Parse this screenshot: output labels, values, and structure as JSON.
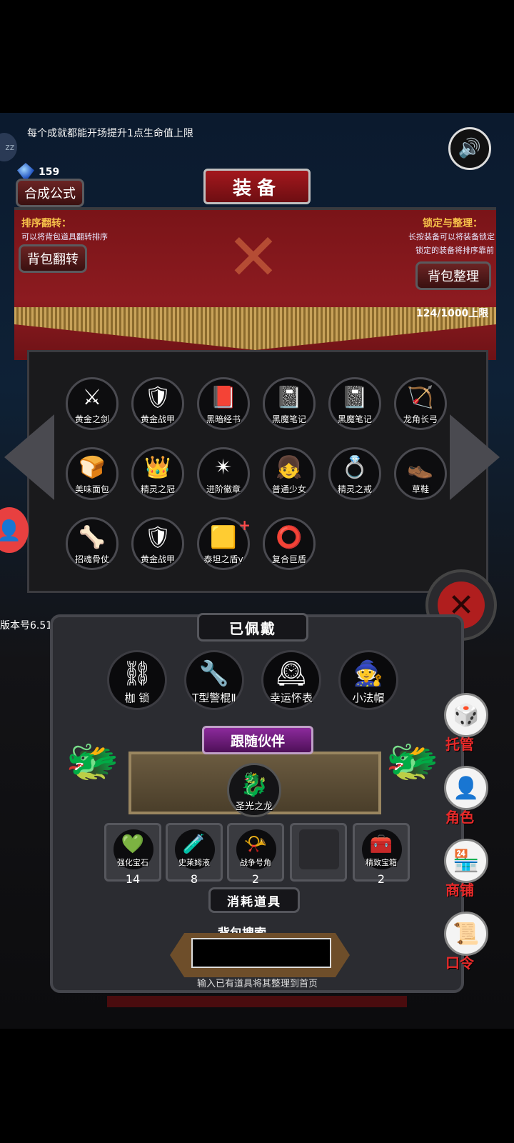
{
  "top_tip": "每个成就都能开场提升1点生命值上限",
  "gems": {
    "count": "159"
  },
  "sleep_label": "zz",
  "icons": {
    "sound": "speaker-icon",
    "close": "close-icon",
    "profile": "person-icon"
  },
  "header": {
    "title": "装备",
    "formula_button": "合成公式"
  },
  "sort": {
    "title": "排序翻转：",
    "desc": "可以将背包道具翻转排序",
    "button": "背包翻转"
  },
  "lock": {
    "title": "锁定与整理：",
    "desc1": "长按装备可以将装备锁定",
    "desc2": "锁定的装备将排序靠前",
    "button": "背包整理"
  },
  "capacity": "124/1000上限",
  "inventory": [
    {
      "name": "黄金之剑",
      "icon": "⚔"
    },
    {
      "name": "黄金战甲",
      "icon": "🛡"
    },
    {
      "name": "黑暗经书",
      "icon": "📕"
    },
    {
      "name": "黑魔笔记",
      "icon": "📓"
    },
    {
      "name": "黑魔笔记",
      "icon": "📓"
    },
    {
      "name": "龙角长弓",
      "icon": "🏹"
    },
    {
      "name": "美味面包",
      "icon": "🍞"
    },
    {
      "name": "精灵之冠",
      "icon": "👑"
    },
    {
      "name": "进阶徽章",
      "icon": "✴"
    },
    {
      "name": "普通少女",
      "icon": "👧"
    },
    {
      "name": "精灵之戒",
      "icon": "💍"
    },
    {
      "name": "草鞋",
      "icon": "👞"
    },
    {
      "name": "招魂骨仗",
      "icon": "🦴"
    },
    {
      "name": "黄金战甲",
      "icon": "🛡"
    },
    {
      "name": "泰坦之盾v",
      "icon": "🟨",
      "plus": "+"
    },
    {
      "name": "复合巨盾",
      "icon": "⭕"
    }
  ],
  "version": "版本号6.51",
  "equipped": {
    "title": "已佩戴",
    "items": [
      {
        "name": "枷 锁",
        "icon": "⛓"
      },
      {
        "name": "T型警棍Ⅱ",
        "icon": "🔧"
      },
      {
        "name": "幸运怀表",
        "icon": "🕰"
      },
      {
        "name": "小法帽",
        "icon": "🧙"
      }
    ]
  },
  "companion": {
    "title": "跟随伙伴",
    "name": "圣光之龙",
    "icon": "🐉"
  },
  "consumables": {
    "title": "消耗道具",
    "items": [
      {
        "name": "强化宝石",
        "icon": "💚",
        "qty": "14"
      },
      {
        "name": "史莱姆液",
        "icon": "🧪",
        "qty": "8"
      },
      {
        "name": "战争号角",
        "icon": "📯",
        "qty": "2"
      },
      {
        "name": "",
        "icon": "",
        "qty": ""
      },
      {
        "name": "精致宝箱",
        "icon": "🧰",
        "qty": "2"
      }
    ]
  },
  "search": {
    "label": "背包搜索",
    "value": "",
    "hint": "输入已有道具将其整理到首页"
  },
  "side_menu": [
    {
      "label": "托管",
      "icon": "🎲"
    },
    {
      "label": "角色",
      "icon": "👤"
    },
    {
      "label": "商铺",
      "icon": "🏪"
    },
    {
      "label": "口令",
      "icon": "📜"
    }
  ]
}
